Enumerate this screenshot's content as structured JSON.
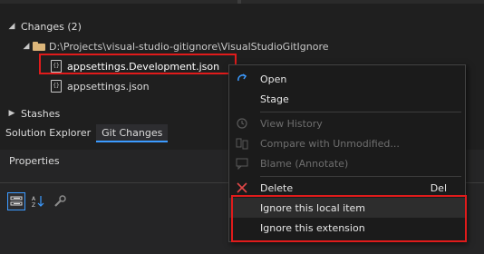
{
  "changes": {
    "header": "Changes (2)",
    "folder_path": "D:\\Projects\\visual-studio-gitignore\\VisualStudioGitIgnore",
    "files": [
      {
        "name": "appsettings.Development.json",
        "icon": "json-file-icon"
      },
      {
        "name": "appsettings.json",
        "icon": "json-file-icon"
      }
    ]
  },
  "stashes": {
    "header": "Stashes"
  },
  "tabs": [
    {
      "label": "Solution Explorer",
      "active": false
    },
    {
      "label": "Git Changes",
      "active": true
    }
  ],
  "properties": {
    "title": "Properties",
    "toolbar": [
      "categorized-icon",
      "alphabetical-icon",
      "wrench-icon"
    ]
  },
  "context_menu": {
    "items": [
      {
        "label": "Open",
        "icon": "open-icon",
        "enabled": true
      },
      {
        "label": "Stage",
        "icon": "",
        "enabled": true
      },
      {
        "label": "View History",
        "icon": "history-icon",
        "enabled": false
      },
      {
        "label": "Compare with Unmodified...",
        "icon": "compare-icon",
        "enabled": false
      },
      {
        "label": "Blame (Annotate)",
        "icon": "blame-icon",
        "enabled": false
      },
      {
        "label": "Delete",
        "icon": "delete-icon",
        "shortcut": "Del",
        "enabled": true
      },
      {
        "label": "Ignore this local item",
        "icon": "",
        "enabled": true
      },
      {
        "label": "Ignore this extension",
        "icon": "",
        "enabled": true
      }
    ]
  },
  "colors": {
    "highlight_box": "#e01b1b",
    "accent": "#3c9bff",
    "folder": "#dcb67a"
  }
}
